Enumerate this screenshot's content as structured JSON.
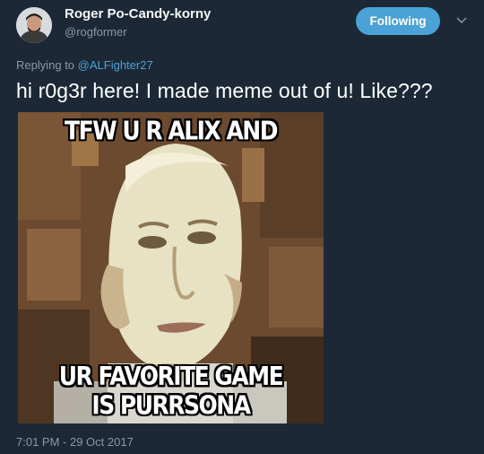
{
  "tweet": {
    "display_name": "Roger Po-Candy-korny",
    "handle": "@rogformer",
    "follow_label": "Following",
    "replying_prefix": "Replying to ",
    "replying_handle": "@ALFighter27",
    "text": "hi r0g3r here! I made meme out of u! Like???",
    "timestamp": "7:01 PM - 29 Oct 2017"
  },
  "meme": {
    "top_caption": "TFW U R ALIX AND",
    "bottom_caption_line1": "UR FAVORITE GAME",
    "bottom_caption_line2": "IS PURRSONA"
  },
  "colors": {
    "background": "#1c2836",
    "accent": "#4ba2d6",
    "muted_text": "#8899a6"
  },
  "icons": {
    "avatar": "user-avatar",
    "chevron": "chevron-down-icon"
  }
}
